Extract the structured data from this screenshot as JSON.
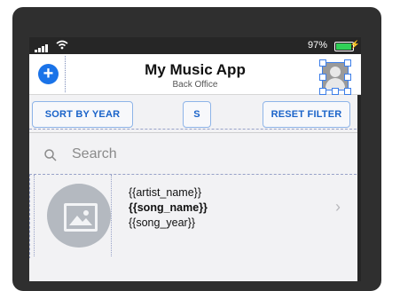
{
  "status_bar": {
    "battery_percent": "97%",
    "battery_level": 0.97,
    "charging_symbol": "⚡"
  },
  "header": {
    "add_symbol": "+",
    "title": "My Music App",
    "subtitle": "Back Office",
    "avatar_icon": "person-icon"
  },
  "filters": {
    "sort_label": "SORT BY YEAR",
    "middle_label": "S",
    "reset_label": "RESET FILTER"
  },
  "search": {
    "placeholder": "Search"
  },
  "list": {
    "items": [
      {
        "artist": "{{artist_name}}",
        "song": "{{song_name}}",
        "year": "{{song_year}}",
        "chevron": "›"
      }
    ]
  },
  "colors": {
    "accent": "#1a73e8",
    "device_frame": "#2f2f2f",
    "background": "#f2f2f4"
  }
}
